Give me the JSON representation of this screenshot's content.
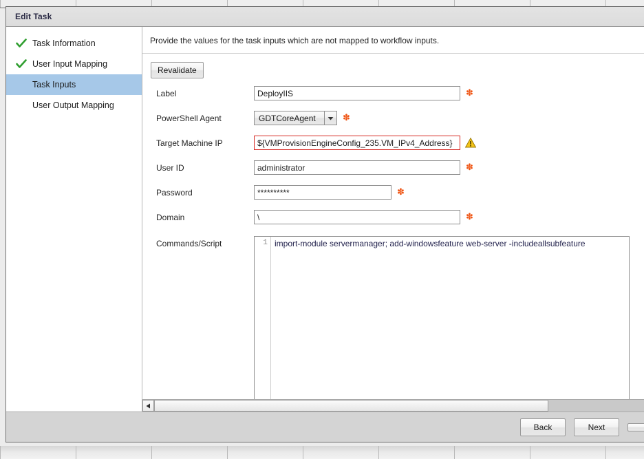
{
  "background": {
    "tab_divider_positions": [
      0,
      110,
      220,
      330,
      440,
      550,
      660,
      770,
      880
    ]
  },
  "dialog": {
    "title": "Edit Task"
  },
  "wizard_nav": {
    "items": [
      {
        "label": "Task Information",
        "state": "completed",
        "selected": false
      },
      {
        "label": "User Input Mapping",
        "state": "completed",
        "selected": false
      },
      {
        "label": "Task Inputs",
        "state": "current",
        "selected": true
      },
      {
        "label": "User Output Mapping",
        "state": "pending",
        "selected": false
      }
    ]
  },
  "content": {
    "description": "Provide the values for the task inputs which are not mapped to workflow inputs.",
    "revalidate_label": "Revalidate",
    "fields": [
      {
        "label": "Label",
        "type": "text",
        "value": "DeployIIS",
        "required": true,
        "error": false,
        "name": "label"
      },
      {
        "label": "PowerShell Agent",
        "type": "select",
        "value": "GDTCoreAgent",
        "required": true,
        "error": false,
        "name": "powershell-agent"
      },
      {
        "label": "Target Machine IP",
        "type": "text",
        "value": "${VMProvisionEngineConfig_235.VM_IPv4_Address}",
        "required": false,
        "error": true,
        "warning": true,
        "name": "target-machine-ip"
      },
      {
        "label": "User ID",
        "type": "text",
        "value": "administrator",
        "required": true,
        "error": false,
        "name": "user-id"
      },
      {
        "label": "Password",
        "type": "password",
        "value": "**********",
        "required": true,
        "error": false,
        "name": "password"
      },
      {
        "label": "Domain",
        "type": "text",
        "value": "\\",
        "required": true,
        "error": false,
        "name": "domain"
      }
    ],
    "script_editor": {
      "label": "Commands/Script",
      "line_number": "1",
      "code": "import-module servermanager; add-windowsfeature web-server -includeallsubfeature"
    }
  },
  "footer": {
    "back_label": "Back",
    "next_label": "Next",
    "third_label": ""
  },
  "colors": {
    "selection": "#a6c8e8",
    "required_asterisk": "#ef5413",
    "error_border": "#d6241e",
    "check_green": "#2f9e2f",
    "warning_yellow": "#f5c518",
    "code_text": "#1f1f4a"
  }
}
